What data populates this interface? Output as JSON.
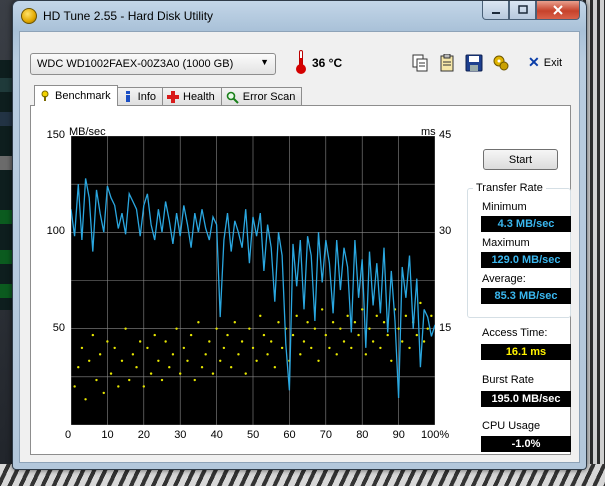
{
  "window": {
    "title": "HD Tune 2.55 - Hard Disk Utility",
    "minimize_icon": "minimize-icon",
    "maximize_icon": "maximize-icon",
    "close_icon": "close-icon"
  },
  "toolbar": {
    "drive": "WDC WD1002FAEX-00Z3A0 (1000 GB)",
    "temperature": "36 °C",
    "exit_label": "Exit",
    "icons": [
      "copy-icon",
      "copy-info-icon",
      "save-icon",
      "options-icon"
    ]
  },
  "tabs": [
    {
      "label": "Benchmark",
      "icon": "benchmark-icon",
      "active": true
    },
    {
      "label": "Info",
      "icon": "info-icon",
      "active": false
    },
    {
      "label": "Health",
      "icon": "health-icon",
      "active": false
    },
    {
      "label": "Error Scan",
      "icon": "error-scan-icon",
      "active": false
    }
  ],
  "controls": {
    "start_label": "Start"
  },
  "results": {
    "transfer_rate_title": "Transfer Rate",
    "minimum_label": "Minimum",
    "minimum_value": "4.3 MB/sec",
    "maximum_label": "Maximum",
    "maximum_value": "129.0 MB/sec",
    "average_label": "Average:",
    "average_value": "85.3 MB/sec",
    "access_time_label": "Access Time:",
    "access_time_value": "16.1 ms",
    "burst_rate_label": "Burst Rate",
    "burst_rate_value": "195.0 MB/sec",
    "cpu_usage_label": "CPU Usage",
    "cpu_usage_value": "-1.0%"
  },
  "chart_data": {
    "type": "line",
    "y_left_label": "MB/sec",
    "y_right_label": "ms",
    "y_left_ticks": [
      "150",
      "100",
      "50"
    ],
    "y_right_ticks": [
      "45",
      "30",
      "15"
    ],
    "x_ticks": [
      "0",
      "10",
      "20",
      "30",
      "40",
      "50",
      "60",
      "70",
      "80",
      "90",
      "100%"
    ],
    "xlim": [
      0,
      100
    ],
    "ylim": [
      0,
      150
    ],
    "y2lim": [
      0,
      45
    ],
    "grid": true,
    "colors": {
      "transfer": "#2aa7e0",
      "access": "#e6e600",
      "background": "#000000",
      "grid": "#8a8a8a"
    },
    "series": [
      {
        "id": "transfer",
        "x": [
          0,
          1,
          2,
          3,
          4,
          5,
          6,
          7,
          8,
          9,
          10,
          11,
          12,
          13,
          14,
          15,
          16,
          17,
          18,
          19,
          20,
          21,
          22,
          23,
          24,
          25,
          26,
          27,
          28,
          29,
          30,
          31,
          32,
          33,
          34,
          35,
          36,
          37,
          38,
          39,
          40,
          41,
          42,
          43,
          44,
          45,
          46,
          47,
          48,
          49,
          50,
          51,
          52,
          53,
          54,
          55,
          56,
          57,
          58,
          59,
          60,
          61,
          62,
          63,
          64,
          65,
          66,
          67,
          68,
          69,
          70,
          71,
          72,
          73,
          74,
          75,
          76,
          77,
          78,
          79,
          80,
          81,
          82,
          83,
          84,
          85,
          86,
          87,
          88,
          89,
          90,
          91,
          92,
          93,
          94,
          95,
          96,
          97,
          98,
          99,
          100
        ],
        "values": [
          112,
          98,
          125,
          96,
          128,
          118,
          90,
          122,
          110,
          100,
          124,
          118,
          114,
          102,
          110,
          99,
          120,
          116,
          112,
          98,
          114,
          120,
          104,
          96,
          112,
          100,
          116,
          106,
          94,
          110,
          98,
          114,
          104,
          92,
          110,
          100,
          112,
          102,
          96,
          108,
          104,
          56,
          96,
          110,
          90,
          106,
          100,
          92,
          112,
          84,
          108,
          98,
          110,
          80,
          104,
          92,
          64,
          100,
          88,
          42,
          18,
          94,
          72,
          96,
          60,
          98,
          88,
          54,
          100,
          74,
          96,
          84,
          58,
          96,
          70,
          92,
          82,
          48,
          96,
          66,
          86,
          40,
          90,
          62,
          84,
          58,
          92,
          48,
          80,
          54,
          14,
          82,
          66,
          88,
          50,
          76,
          30,
          60,
          56,
          46,
          52
        ]
      },
      {
        "id": "access",
        "x": [
          1,
          2,
          3,
          4,
          5,
          6,
          7,
          8,
          9,
          10,
          11,
          12,
          13,
          14,
          15,
          16,
          17,
          18,
          19,
          20,
          21,
          22,
          23,
          24,
          25,
          26,
          27,
          28,
          29,
          30,
          31,
          32,
          33,
          34,
          35,
          36,
          37,
          38,
          39,
          40,
          41,
          42,
          43,
          44,
          45,
          46,
          47,
          48,
          49,
          50,
          51,
          52,
          53,
          54,
          55,
          56,
          57,
          58,
          59,
          60,
          61,
          62,
          63,
          64,
          65,
          66,
          67,
          68,
          69,
          70,
          71,
          72,
          73,
          74,
          75,
          76,
          77,
          78,
          79,
          80,
          81,
          82,
          83,
          84,
          85,
          86,
          87,
          88,
          89,
          90,
          91,
          92,
          93,
          94,
          95,
          96,
          97,
          98,
          99
        ],
        "values": [
          6,
          9,
          12,
          4,
          10,
          14,
          7,
          11,
          5,
          13,
          8,
          12,
          6,
          10,
          15,
          7,
          11,
          9,
          13,
          6,
          12,
          8,
          14,
          10,
          7,
          13,
          9,
          11,
          15,
          8,
          12,
          10,
          14,
          7,
          16,
          9,
          11,
          13,
          8,
          15,
          10,
          12,
          14,
          9,
          16,
          11,
          13,
          8,
          15,
          12,
          10,
          17,
          14,
          11,
          13,
          9,
          16,
          12,
          15,
          10,
          14,
          17,
          11,
          13,
          16,
          12,
          15,
          10,
          18,
          14,
          12,
          16,
          11,
          15,
          13,
          17,
          12,
          16,
          14,
          18,
          11,
          15,
          13,
          17,
          12,
          16,
          14,
          10,
          18,
          15,
          13,
          17,
          12,
          16,
          14,
          19,
          13,
          15,
          17
        ]
      }
    ]
  }
}
